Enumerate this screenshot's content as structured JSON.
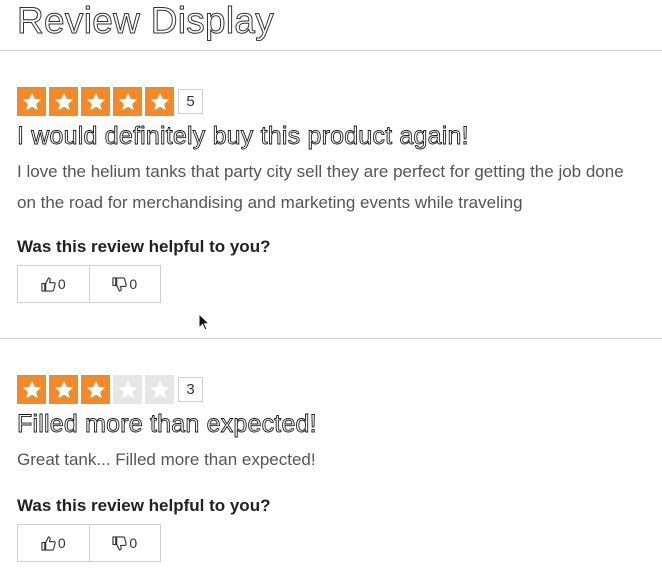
{
  "page": {
    "title": "Review Display"
  },
  "colors": {
    "star_filled": "#f08a2a",
    "star_empty": "#e6e6e6",
    "divider": "#cfcfcf"
  },
  "reviews": [
    {
      "rating": 5,
      "max_rating": 5,
      "rating_label": "5",
      "title": "I would definitely buy this product again!",
      "body": "I love the helium tanks that party city sell they are perfect for getting the job done on the road for merchandising and marketing events while traveling",
      "helpful_prompt": "Was this review helpful to you?",
      "helpful_yes": "0",
      "helpful_no": "0"
    },
    {
      "rating": 3,
      "max_rating": 5,
      "rating_label": "3",
      "title": "Filled more than expected!",
      "body": "Great tank... Filled more than expected!",
      "helpful_prompt": "Was this review helpful to you?",
      "helpful_yes": "0",
      "helpful_no": "0"
    }
  ],
  "icons": {
    "star": "star-icon",
    "thumbs_up": "thumbs-up-icon",
    "thumbs_down": "thumbs-down-icon",
    "cursor": "mouse-cursor-icon"
  }
}
